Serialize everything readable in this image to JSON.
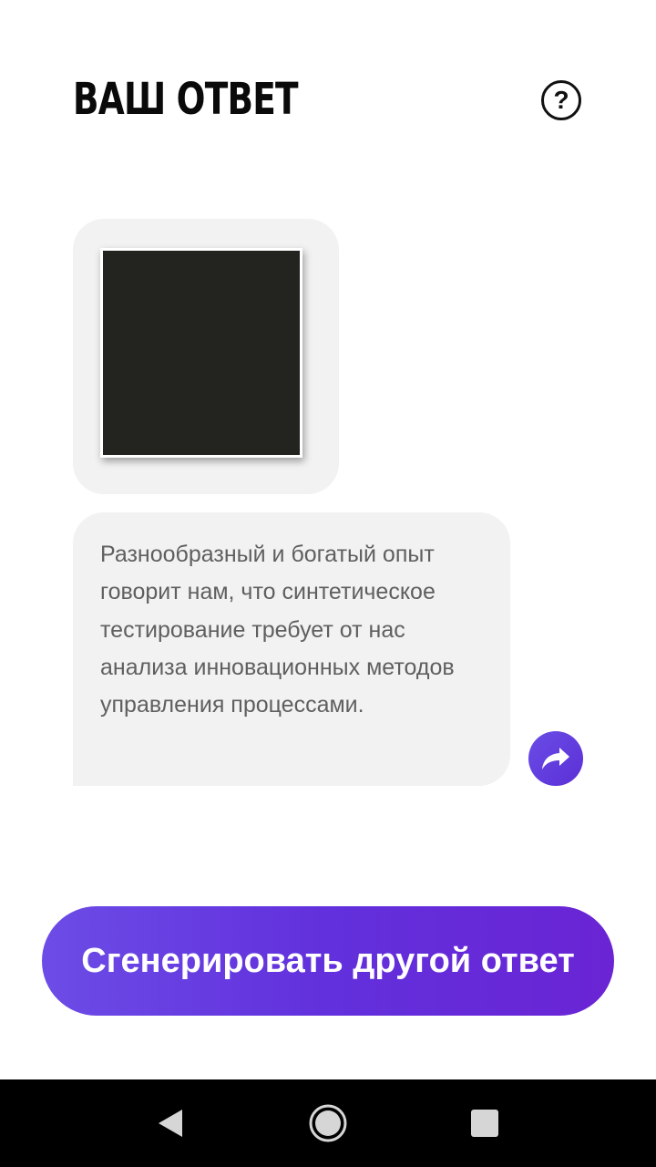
{
  "header": {
    "title": "ВАШ ОТВЕТ",
    "help_glyph": "?",
    "help_icon": "question-circle-icon"
  },
  "answer": {
    "image_icon": "generated-image",
    "text": "Разнообразный и богатый опыт говорит нам, что синтетическое тестирование требует от нас анализа инновационных методов управления процессами.",
    "share_icon": "share-forward-icon"
  },
  "actions": {
    "generate_label": "Сгенерировать другой ответ"
  },
  "colors": {
    "accent_start": "#6c4ce6",
    "accent_end": "#6a24d4",
    "bubble_bg": "#f2f2f2",
    "text_gray": "#5f5f5f",
    "title": "#0a0a0a"
  },
  "nav": {
    "back_icon": "back-triangle-icon",
    "home_icon": "home-circle-icon",
    "recents_icon": "recents-square-icon"
  }
}
